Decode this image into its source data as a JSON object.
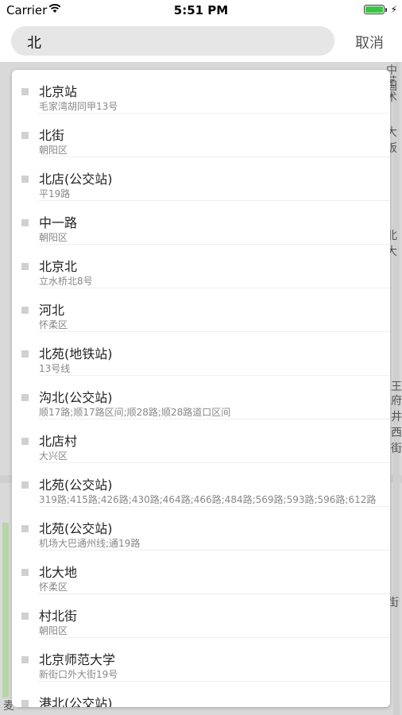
{
  "status_bar": {
    "carrier": "Carrier",
    "time": "5:51 PM",
    "battery_level": 1.0,
    "battery_color": "#3cc447"
  },
  "search": {
    "query": "北",
    "cancel_label": "取消"
  },
  "map_labels": [
    "中国",
    "艺术",
    "大饭",
    "北大",
    "王",
    "府",
    "井",
    "西",
    "街",
    "街",
    "麦"
  ],
  "results": [
    {
      "name": "北京站",
      "address": "毛家湾胡同甲13号"
    },
    {
      "name": "北街",
      "address": "朝阳区"
    },
    {
      "name": "北店(公交站)",
      "address": "平19路"
    },
    {
      "name": "中一路",
      "address": "朝阳区"
    },
    {
      "name": "北京北",
      "address": "立水桥北8号"
    },
    {
      "name": "河北",
      "address": "怀柔区"
    },
    {
      "name": "北苑(地铁站)",
      "address": "13号线"
    },
    {
      "name": "沟北(公交站)",
      "address": "顺17路;顺17路区间;顺28路;顺28路道口区间"
    },
    {
      "name": "北店村",
      "address": "大兴区"
    },
    {
      "name": "北苑(公交站)",
      "address": "319路;415路;426路;430路;464路;466路;484路;569路;593路;596路;612路"
    },
    {
      "name": "北苑(公交站)",
      "address": "机场大巴通州线;通19路"
    },
    {
      "name": "北大地",
      "address": "怀柔区"
    },
    {
      "name": "村北街",
      "address": "朝阳区"
    },
    {
      "name": "北京师范大学",
      "address": "新街口外大街19号"
    },
    {
      "name": "港北(公交站)",
      "address": ""
    }
  ]
}
